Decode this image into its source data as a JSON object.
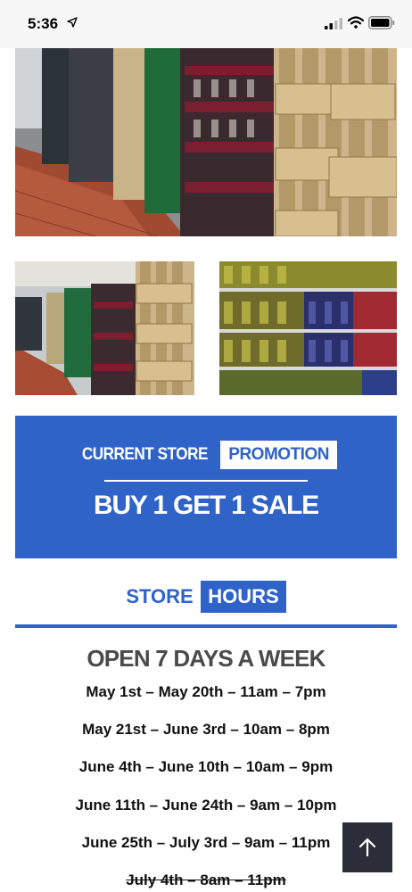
{
  "status_bar": {
    "time": "5:36",
    "icons": [
      "location-arrow-icon",
      "signal-icon",
      "wifi-icon",
      "battery-icon"
    ]
  },
  "gallery": {
    "images": [
      "store-aisle-hero-photo",
      "store-aisle-left-photo",
      "store-shelves-right-photo"
    ]
  },
  "promotion": {
    "label_plain": "CURRENT STORE",
    "label_boxed": "PROMOTION",
    "title": "BUY 1 GET 1 SALE"
  },
  "hours": {
    "heading_plain": "STORE",
    "heading_boxed": "HOURS",
    "open_title": "OPEN 7 DAYS A WEEK",
    "schedule": [
      "May 1st – May 20th – 11am – 7pm",
      "May 21st – June 3rd – 10am – 8pm",
      "June 4th – June 10th – 10am – 9pm",
      "June 11th – June 24th – 9am – 10pm",
      "June 25th – July 3rd – 9am – 11pm",
      "July 4th – 8am – 11pm"
    ]
  },
  "back_to_top": {
    "icon": "arrow-up-icon"
  },
  "colors": {
    "brand_blue": "#2f63c8",
    "dark_button": "#2b2e38",
    "heading_gray": "#4a4a4a"
  }
}
